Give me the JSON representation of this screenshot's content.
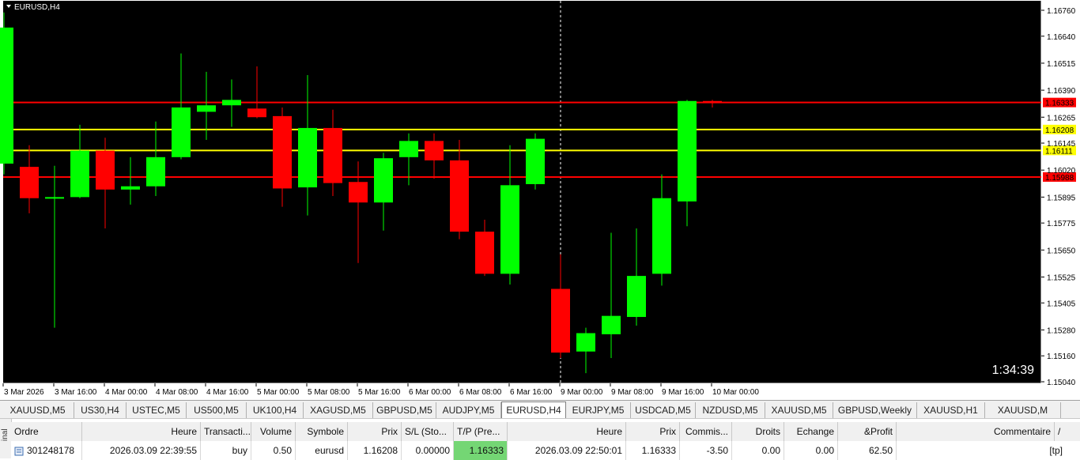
{
  "chart": {
    "title": "EURUSD,H4",
    "timer": "1:34:39",
    "colors": {
      "bg": "#000000",
      "bull": "#00ff00",
      "bear": "#ff0000",
      "grid_text": "#000000",
      "red_line": "#ff0000",
      "yellow_line": "#ffff00"
    },
    "price_axis_ticks": [
      "1.16760",
      "1.16640",
      "1.16515",
      "1.16390",
      "1.16265",
      "1.16145",
      "1.16020",
      "1.15895",
      "1.15775",
      "1.15650",
      "1.15525",
      "1.15405",
      "1.15280",
      "1.15160",
      "1.15040"
    ],
    "time_labels": [
      "3 Mar 2026",
      "3 Mar 16:00",
      "4 Mar 00:00",
      "4 Mar 08:00",
      "4 Mar 16:00",
      "5 Mar 00:00",
      "5 Mar 08:00",
      "5 Mar 16:00",
      "6 Mar 00:00",
      "6 Mar 08:00",
      "6 Mar 16:00",
      "9 Mar 00:00",
      "9 Mar 08:00",
      "9 Mar 16:00",
      "10 Mar 00:00"
    ],
    "level_lines": [
      {
        "price": "1.16333",
        "color": "#ff0000",
        "tag_bg": "#ff0000",
        "tag_fg": "#000000"
      },
      {
        "price": "1.16208",
        "color": "#ffff00",
        "tag_bg": "#ffff00",
        "tag_fg": "#000000"
      },
      {
        "price": "1.16111",
        "color": "#ffff00",
        "tag_bg": "#ffff00",
        "tag_fg": "#000000"
      },
      {
        "price": "1.15988",
        "color": "#ff0000",
        "tag_bg": "#ff0000",
        "tag_fg": "#000000"
      }
    ]
  },
  "chart_data": {
    "type": "candlestick",
    "symbol": "EURUSD",
    "timeframe": "H4",
    "ylim": [
      1.15,
      1.168
    ],
    "candles": [
      {
        "o": 1.1605,
        "h": 1.1675,
        "l": 1.16,
        "c": 1.1668
      },
      {
        "o": 1.16035,
        "h": 1.16135,
        "l": 1.1582,
        "c": 1.1589
      },
      {
        "o": 1.1589,
        "h": 1.1604,
        "l": 1.1529,
        "c": 1.15895
      },
      {
        "o": 1.15895,
        "h": 1.1623,
        "l": 1.1589,
        "c": 1.1611
      },
      {
        "o": 1.1611,
        "h": 1.1617,
        "l": 1.1575,
        "c": 1.1593
      },
      {
        "o": 1.1593,
        "h": 1.1608,
        "l": 1.1586,
        "c": 1.15945
      },
      {
        "o": 1.15945,
        "h": 1.16245,
        "l": 1.159,
        "c": 1.1608
      },
      {
        "o": 1.1608,
        "h": 1.1656,
        "l": 1.1607,
        "c": 1.1631
      },
      {
        "o": 1.1629,
        "h": 1.16475,
        "l": 1.1616,
        "c": 1.1632
      },
      {
        "o": 1.1632,
        "h": 1.1644,
        "l": 1.1622,
        "c": 1.16345
      },
      {
        "o": 1.16305,
        "h": 1.165,
        "l": 1.1626,
        "c": 1.16265
      },
      {
        "o": 1.1627,
        "h": 1.1631,
        "l": 1.1585,
        "c": 1.15935
      },
      {
        "o": 1.1594,
        "h": 1.1646,
        "l": 1.1581,
        "c": 1.16215
      },
      {
        "o": 1.16215,
        "h": 1.163,
        "l": 1.159,
        "c": 1.1596
      },
      {
        "o": 1.15965,
        "h": 1.1606,
        "l": 1.1559,
        "c": 1.1587
      },
      {
        "o": 1.1587,
        "h": 1.161,
        "l": 1.1574,
        "c": 1.16075
      },
      {
        "o": 1.1608,
        "h": 1.1619,
        "l": 1.1595,
        "c": 1.16155
      },
      {
        "o": 1.16155,
        "h": 1.1619,
        "l": 1.1598,
        "c": 1.16065
      },
      {
        "o": 1.16065,
        "h": 1.1616,
        "l": 1.157,
        "c": 1.15735
      },
      {
        "o": 1.15735,
        "h": 1.1579,
        "l": 1.1553,
        "c": 1.1554
      },
      {
        "o": 1.1554,
        "h": 1.16135,
        "l": 1.1549,
        "c": 1.1595
      },
      {
        "o": 1.15955,
        "h": 1.1619,
        "l": 1.1593,
        "c": 1.16165
      },
      {
        "o": 1.1547,
        "h": 1.1563,
        "l": 1.1515,
        "c": 1.15175
      },
      {
        "o": 1.1518,
        "h": 1.1529,
        "l": 1.1508,
        "c": 1.15265
      },
      {
        "o": 1.1526,
        "h": 1.1573,
        "l": 1.1515,
        "c": 1.15345
      },
      {
        "o": 1.1534,
        "h": 1.1575,
        "l": 1.153,
        "c": 1.1553
      },
      {
        "o": 1.1554,
        "h": 1.16,
        "l": 1.15485,
        "c": 1.1589
      },
      {
        "o": 1.15875,
        "h": 1.16345,
        "l": 1.1576,
        "c": 1.1634
      },
      {
        "o": 1.1634,
        "h": 1.16345,
        "l": 1.1631,
        "c": 1.1633
      }
    ]
  },
  "tabs": [
    {
      "label": "XAUUSD,M5",
      "active": false
    },
    {
      "label": "US30,H4",
      "active": false
    },
    {
      "label": "USTEC,M5",
      "active": false
    },
    {
      "label": "US500,M5",
      "active": false
    },
    {
      "label": "UK100,H4",
      "active": false
    },
    {
      "label": "XAGUSD,M5",
      "active": false
    },
    {
      "label": "GBPUSD,M5",
      "active": false
    },
    {
      "label": "AUDJPY,M5",
      "active": false
    },
    {
      "label": "EURUSD,H4",
      "active": true
    },
    {
      "label": "EURJPY,M5",
      "active": false
    },
    {
      "label": "USDCAD,M5",
      "active": false
    },
    {
      "label": "NZDUSD,M5",
      "active": false
    },
    {
      "label": "XAUUSD,M5",
      "active": false
    },
    {
      "label": "GBPUSD,Weekly",
      "active": false
    },
    {
      "label": "XAUUSD,H1",
      "active": false
    },
    {
      "label": "XAUUSD,M",
      "active": false
    }
  ],
  "terminal": {
    "side_label": "inal",
    "columns": {
      "ordre": "Ordre",
      "heure": "Heure",
      "transaction": "Transacti...",
      "volume": "Volume",
      "symbole": "Symbole",
      "prix": "Prix",
      "sl": "S/L (Sto...",
      "tp": "T/P (Pre...",
      "heure2": "Heure",
      "prix2": "Prix",
      "commission": "Commis...",
      "droits": "Droits",
      "echange": "Echange",
      "profit": "&Profit",
      "commentaire": "Commentaire",
      "sort_icon": "/"
    },
    "row": {
      "ordre": "301248178",
      "heure": "2026.03.09 22:39:55",
      "transaction": "buy",
      "volume": "0.50",
      "symbole": "eurusd",
      "prix": "1.16208",
      "sl": "0.00000",
      "tp": "1.16333",
      "heure2": "2026.03.09 22:50:01",
      "prix2": "1.16333",
      "commission": "-3.50",
      "droits": "0.00",
      "echange": "0.00",
      "profit": "62.50",
      "commentaire": "[tp]"
    }
  }
}
